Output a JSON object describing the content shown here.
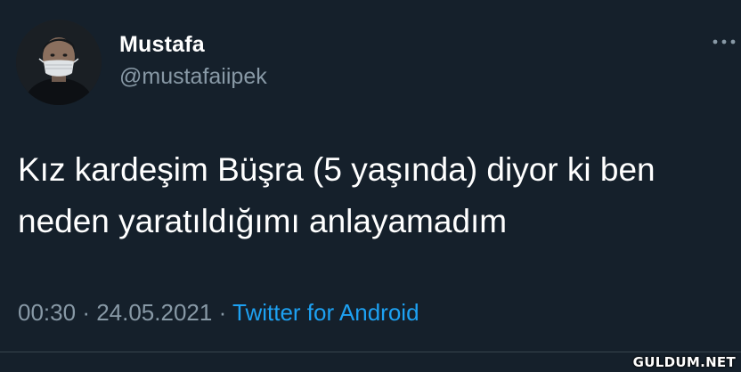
{
  "author": {
    "display_name": "Mustafa",
    "handle": "@mustafaiipek",
    "avatar": "avatar-photo"
  },
  "menu": {
    "icon": "more-horizontal-icon"
  },
  "tweet": {
    "text_lines": [
      "Kız kardeşim Büşra (5 yaşında) diyor ki ben",
      "neden yaratıldığımı anlayamadım"
    ]
  },
  "meta": {
    "time": "00:30",
    "separator": "·",
    "date": "24.05.2021",
    "source": "Twitter for Android"
  },
  "watermark": "GULDUM.NET",
  "colors": {
    "background": "#15202b",
    "text": "#ffffff",
    "muted": "#8899a6",
    "link": "#1da1f2"
  }
}
